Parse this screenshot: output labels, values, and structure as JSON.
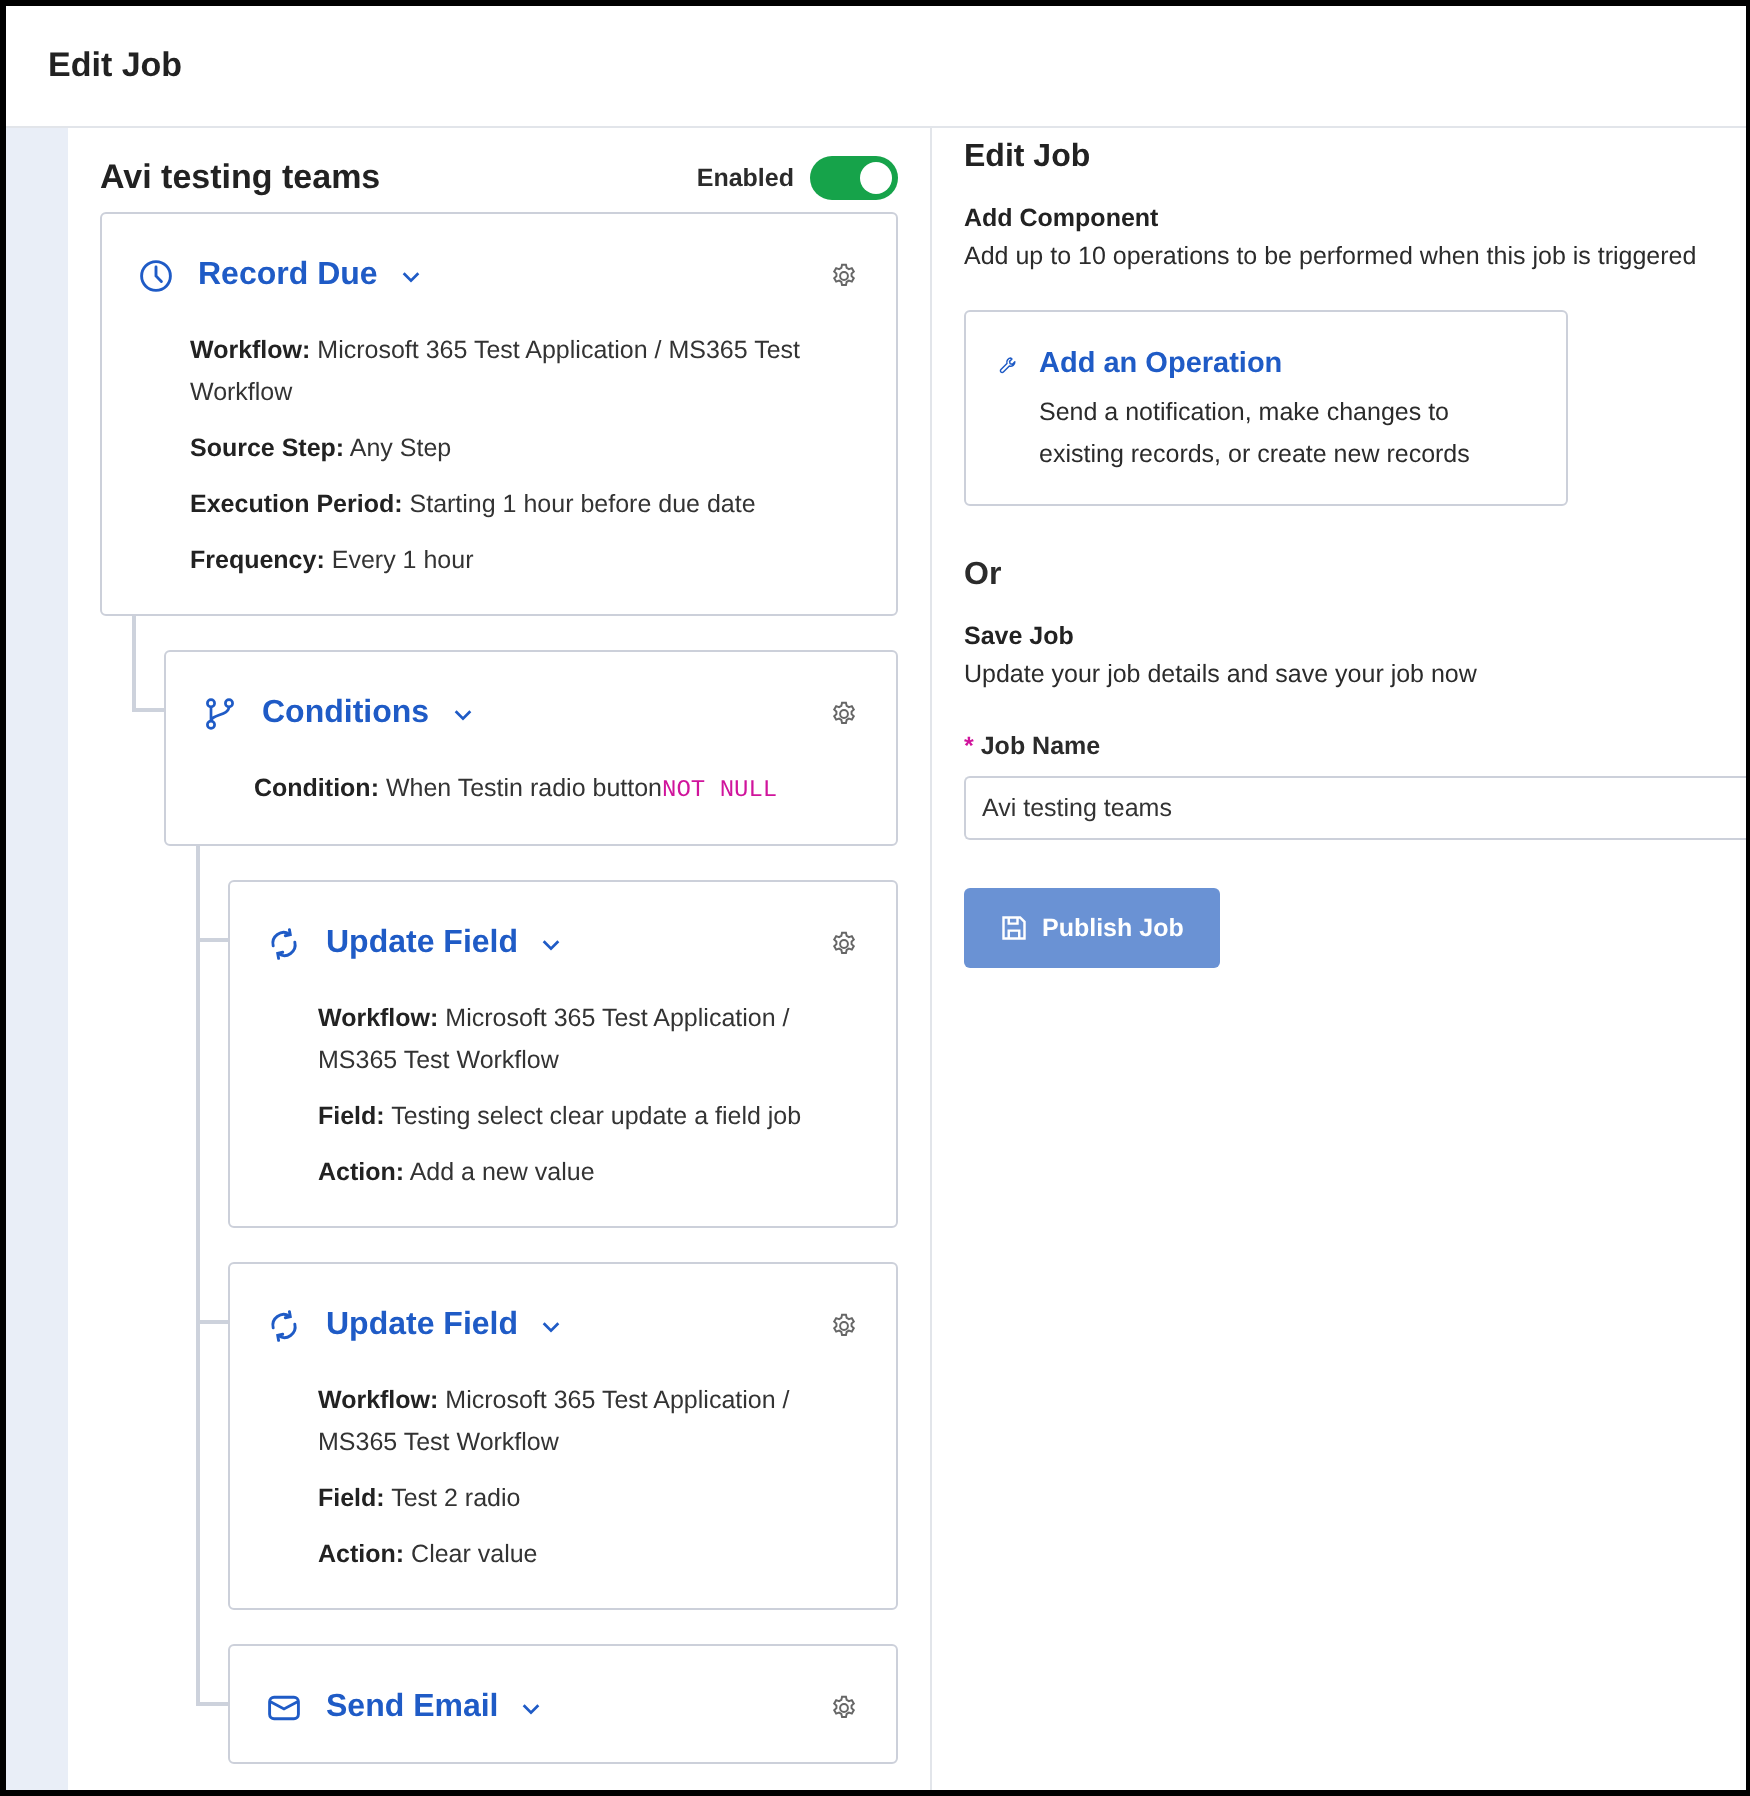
{
  "header": {
    "title": "Edit Job"
  },
  "job": {
    "title": "Avi testing teams",
    "toggle": {
      "label": "Enabled",
      "on": true
    },
    "steps": [
      {
        "kind": "clock",
        "title": "Record Due",
        "details": [
          {
            "label": "Workflow:",
            "value": "Microsoft 365 Test Application / MS365 Test Workflow"
          },
          {
            "label": "Source Step:",
            "value": "Any Step"
          },
          {
            "label": "Execution Period:",
            "value": "Starting 1 hour before due date"
          },
          {
            "label": "Frequency:",
            "value": "Every 1 hour"
          }
        ],
        "children": [
          {
            "kind": "branch",
            "title": "Conditions",
            "details": [
              {
                "label": "Condition:",
                "value": "When Testin radio button",
                "operator": "NOT NULL"
              }
            ],
            "children": [
              {
                "kind": "refresh",
                "title": "Update Field",
                "details": [
                  {
                    "label": "Workflow:",
                    "value": "Microsoft 365 Test Application / MS365 Test Workflow"
                  },
                  {
                    "label": "Field:",
                    "value": "Testing select clear update a field job"
                  },
                  {
                    "label": "Action:",
                    "value": "Add a new value"
                  }
                ]
              },
              {
                "kind": "refresh",
                "title": "Update Field",
                "details": [
                  {
                    "label": "Workflow:",
                    "value": "Microsoft 365 Test Application / MS365 Test Workflow"
                  },
                  {
                    "label": "Field:",
                    "value": "Test 2 radio"
                  },
                  {
                    "label": "Action:",
                    "value": "Clear value"
                  }
                ]
              },
              {
                "kind": "mail",
                "title": "Send Email"
              }
            ]
          }
        ]
      }
    ]
  },
  "panel": {
    "title": "Edit Job",
    "add_component": {
      "heading": "Add Component",
      "description": "Add up to 10 operations to be performed when this job is triggered"
    },
    "operation_card": {
      "title": "Add an Operation",
      "description": "Send a notification, make changes to existing records, or create new records"
    },
    "separator": "Or",
    "save_job": {
      "heading": "Save Job",
      "description": "Update your job details and save your job now"
    },
    "job_name": {
      "label": "Job Name",
      "required": "*",
      "value": "Avi testing teams"
    },
    "publish_button": {
      "label": "Publish Job",
      "disabled": true
    }
  }
}
